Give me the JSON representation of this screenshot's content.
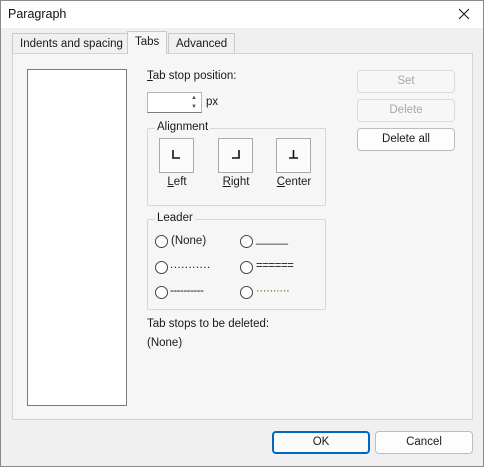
{
  "window": {
    "title": "Paragraph"
  },
  "tabs": [
    {
      "label": "Indents and spacing"
    },
    {
      "label": "Tabs"
    },
    {
      "label": "Advanced"
    }
  ],
  "tab_stop": {
    "label_first": "T",
    "label_rest": "ab stop position:",
    "value": "",
    "unit": "px"
  },
  "alignment": {
    "title": "Alignment",
    "options": [
      {
        "label_first": "L",
        "label_rest": "eft"
      },
      {
        "label_first": "R",
        "label_rest": "ight"
      },
      {
        "label_first": "C",
        "label_rest": "enter"
      }
    ]
  },
  "leader": {
    "title": "Leader",
    "options": [
      {
        "label": "(None)"
      },
      {
        "label": "_____"
      },
      {
        "label": "..........."
      },
      {
        "label": "======"
      },
      {
        "label": "----------"
      },
      {
        "label": "··········"
      }
    ]
  },
  "to_delete": {
    "label": "Tab stops to be deleted:",
    "value": "(None)"
  },
  "actions": {
    "set": "Set",
    "delete": "Delete",
    "delete_all": "Delete all"
  },
  "footer": {
    "ok": "OK",
    "cancel": "Cancel"
  }
}
